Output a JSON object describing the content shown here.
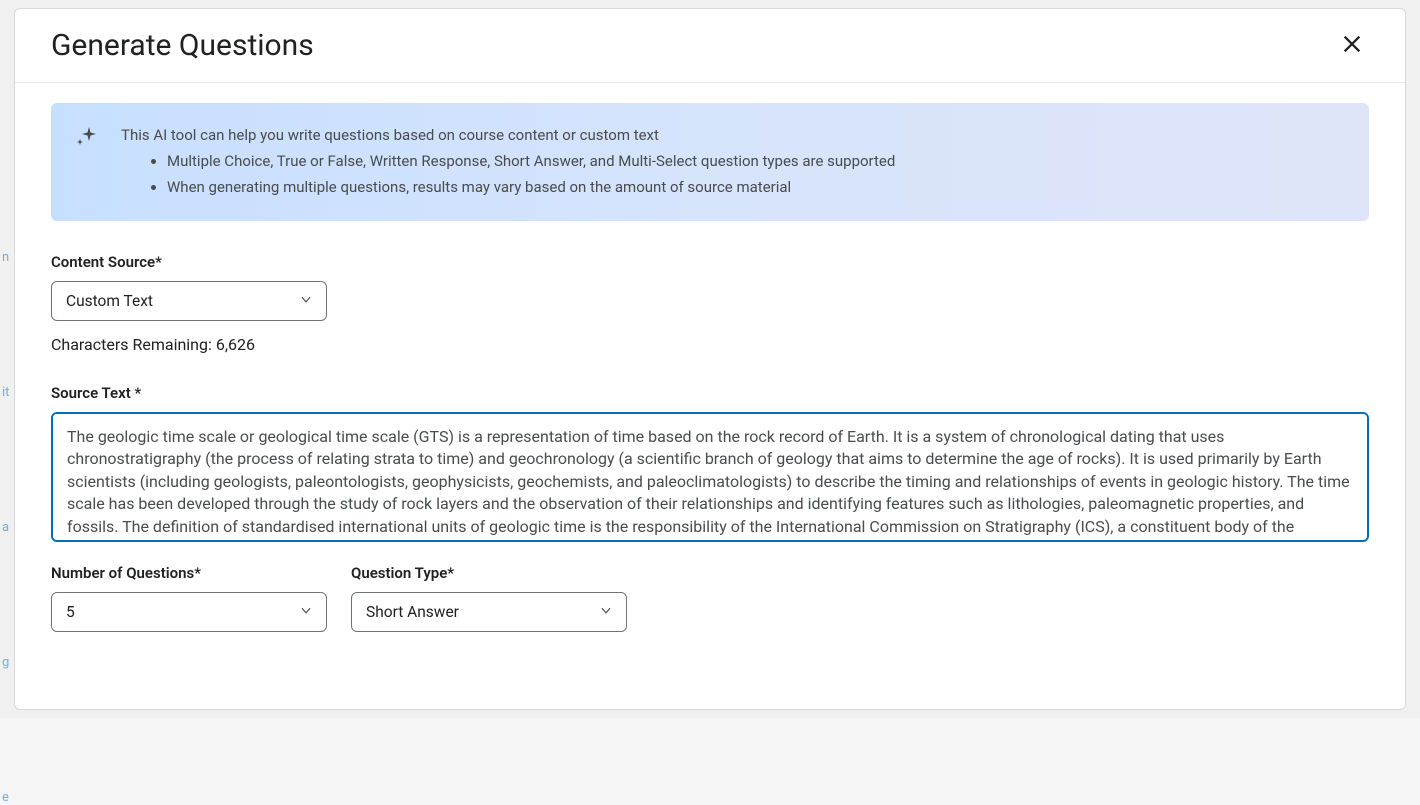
{
  "modal": {
    "title": "Generate Questions"
  },
  "info": {
    "lead": "This AI tool can help you write questions based on course content or custom text",
    "bullets": [
      "Multiple Choice, True or False, Written Response, Short Answer, and Multi-Select question types are supported",
      "When generating multiple questions, results may vary based on the amount of source material"
    ]
  },
  "contentSource": {
    "label": "Content Source*",
    "value": "Custom Text"
  },
  "charsRemaining": "Characters Remaining: 6,626",
  "sourceText": {
    "label": "Source Text *",
    "value": "The geologic time scale or geological time scale (GTS) is a representation of time based on the rock record of Earth. It is a system of chronological dating that uses chronostratigraphy (the process of relating strata to time) and geochronology (a scientific branch of geology that aims to determine the age of rocks). It is used primarily by Earth scientists (including geologists, paleontologists, geophysicists, geochemists, and paleoclimatologists) to describe the timing and relationships of events in geologic history. The time scale has been developed through the study of rock layers and the observation of their relationships and identifying features such as lithologies, paleomagnetic properties, and fossils. The definition of standardised international units of geologic time is the responsibility of the International Commission on Stratigraphy (ICS), a constituent body of the International Union of Geological Sciences (IUGS), whose"
  },
  "numQuestions": {
    "label": "Number of Questions*",
    "value": "5"
  },
  "questionType": {
    "label": "Question Type*",
    "value": "Short Answer"
  }
}
